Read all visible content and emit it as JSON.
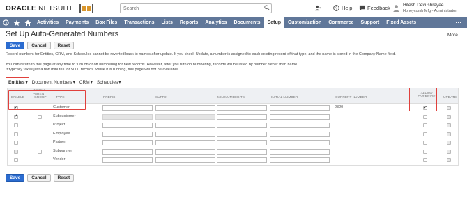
{
  "header": {
    "logo_bold": "ORACLE",
    "logo_light": "NETSUITE",
    "search_placeholder": "Search",
    "help_label": "Help",
    "feedback_label": "Feedback",
    "user_name": "Hitesh Devushrayee",
    "user_role": "Honeycomb Mfg - Administrator"
  },
  "nav": {
    "items": [
      "Activities",
      "Payments",
      "Box Files",
      "Transactions",
      "Lists",
      "Reports",
      "Analytics",
      "Documents",
      "Setup",
      "Customization",
      "Commerce",
      "Support",
      "Fixed Assets"
    ],
    "active": "Setup",
    "more": "⋯"
  },
  "page": {
    "title": "Set Up Auto-Generated Numbers",
    "more_label": "More"
  },
  "buttons": {
    "save": "Save",
    "cancel": "Cancel",
    "reset": "Reset"
  },
  "info": {
    "line1": "Record numbers for Entities, CRM, and Schedules cannot be reverted back to names after update. If you check Update, a number is assigned to each existing record of that type, and the name is stored in the Company Name field.",
    "line2": "You can return to this page at any time to turn on or off numbering for new records. However, after you turn on numbering, records will be listed by number rather than name.",
    "line3": "It typically takes just a few minutes for 5000 records. While it is running, this page will not be available."
  },
  "subtabs": [
    {
      "label": "Entities",
      "active": true
    },
    {
      "label": "Document Numbers",
      "active": false
    },
    {
      "label": "CRM",
      "active": false
    },
    {
      "label": "Schedules",
      "active": false
    }
  ],
  "table": {
    "columns": {
      "enable": "ENABLE",
      "within_parent": "WITHIN PARENT",
      "group": "GROUP",
      "type": "TYPE",
      "prefix": "PREFIX",
      "suffix": "SUFFIX",
      "min_digits": "MINIMUM DIGITS",
      "initial_number": "INITIAL NUMBER",
      "current_number": "CURRENT NUMBER",
      "allow_override": "ALLOW OVERRIDE",
      "update": "UPDATE"
    },
    "rows": [
      {
        "type": "Customer",
        "enable": true,
        "current_number": "2320",
        "allow_override": true
      },
      {
        "type": "Subcustomer",
        "enable": true,
        "current_number": "",
        "allow_override": false
      },
      {
        "type": "Project",
        "enable": false,
        "current_number": "",
        "allow_override": false
      },
      {
        "type": "Employee",
        "enable": false,
        "current_number": "",
        "allow_override": false
      },
      {
        "type": "Partner",
        "enable": false,
        "current_number": "",
        "allow_override": false
      },
      {
        "type": "Subpartner",
        "enable": false,
        "current_number": "",
        "allow_override": false
      },
      {
        "type": "Vendor",
        "enable": false,
        "current_number": "",
        "allow_override": false
      }
    ]
  },
  "colors": {
    "nav_bg": "#607799",
    "primary_button": "#2b6cd0",
    "highlight": "#e0403c"
  }
}
